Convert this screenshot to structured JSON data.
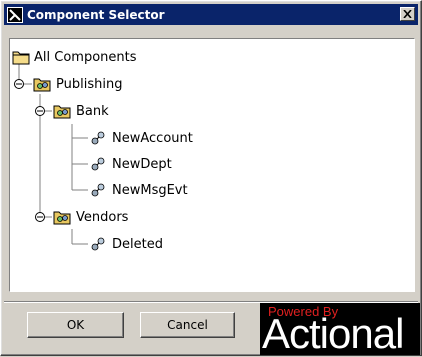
{
  "window": {
    "title": "Component Selector"
  },
  "tree": {
    "root_label": "All Components",
    "nodes": [
      {
        "label": "Publishing",
        "type": "package"
      },
      {
        "label": "Bank",
        "type": "package"
      },
      {
        "label": "NewAccount",
        "type": "component"
      },
      {
        "label": "NewDept",
        "type": "component"
      },
      {
        "label": "NewMsgEvt",
        "type": "component"
      },
      {
        "label": "Vendors",
        "type": "package"
      },
      {
        "label": "Deleted",
        "type": "component"
      }
    ]
  },
  "buttons": {
    "ok": "OK",
    "cancel": "Cancel"
  },
  "logo": {
    "tagline": "Powered By",
    "brand": "Actional"
  },
  "colors": {
    "titlebar": "#0a246a",
    "logo_accent": "#e02020"
  }
}
